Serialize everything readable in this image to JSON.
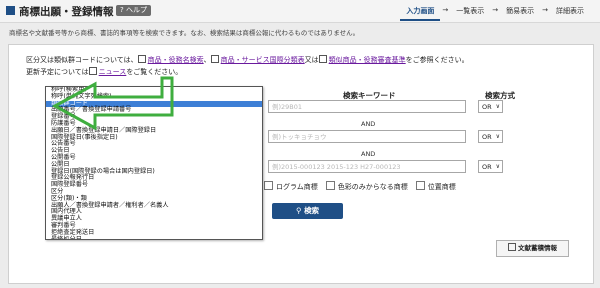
{
  "header": {
    "title": "商標出願・登録情報",
    "help_label": "? ヘルプ",
    "steps": [
      "入力画面",
      "一覧表示",
      "簡易表示",
      "詳細表示"
    ]
  },
  "subtitle": "商標名や文献番号等から商標、書誌的事項等を検索できます。なお、検索結果は商標公報に代わるものではありません。",
  "info": {
    "line1_prefix": "区分又は類似群コードについては、",
    "link1": "商品・役務名検索",
    "sep1": "、",
    "link2": "商品・サービス国際分類表",
    "sep2": "又は",
    "link3": "類似商品・役務審査基準",
    "line1_suffix": "をご参照ください。",
    "line2_prefix": "更新予定については",
    "link4": "ニュース",
    "line2_suffix": "をご覧ください。"
  },
  "search": {
    "keyword_header": "検索キーワード",
    "method_header": "検索方式",
    "inputs": [
      {
        "placeholder": "例)29B01"
      },
      {
        "placeholder": "例)トッキョチョウ"
      },
      {
        "placeholder": "例)2015-000123 2015-123 H27-000123"
      }
    ],
    "and_label": "AND",
    "method_value": "OR",
    "search_button": "検索"
  },
  "checkboxes": [
    "ログラム商標",
    "色彩のみからなる商標",
    "位置商標"
  ],
  "dropdown_items": [
    "称呼(検索用)",
    "称呼(単純文字列検索)",
    "類似群コード",
    "出願番号／書換登録申請番号",
    "登録番号",
    "防護番号",
    "出願日／書換登録申請日／国際登録日",
    "国際登録日(事後指定日)",
    "公告番号",
    "公告日",
    "公開番号",
    "公開日",
    "登録日(国際登録の場合は国内登録日)",
    "登録公報発行日",
    "国際登録番号",
    "区分",
    "区分(類)・類",
    "出願人／書換登録申請者／権利者／名義人",
    "国内代理人",
    "異議申立人",
    "審判番号",
    "拒絶査定発送日",
    "最終処分日"
  ],
  "selected_index": 2,
  "bibliography_button": "文献蓄積情報",
  "colors": {
    "accent": "#1f4f86",
    "selection": "#3d7fd6",
    "arrow": "#3fae3f"
  }
}
